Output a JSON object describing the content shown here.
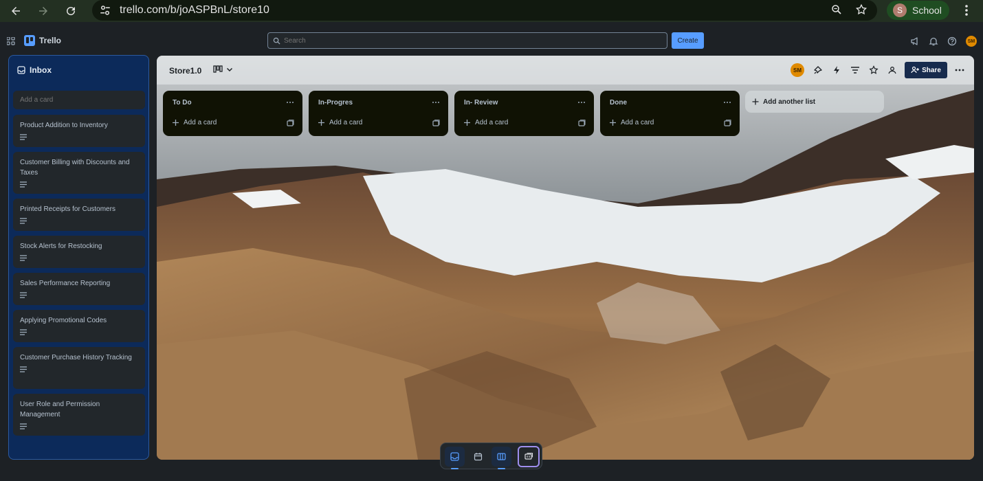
{
  "browser": {
    "url": "trello.com/b/joASPBnL/store10",
    "profile_initial": "S",
    "profile_name": "School"
  },
  "header": {
    "app_name": "Trello",
    "search_placeholder": "Search",
    "create_label": "Create",
    "avatar_initials": "SM"
  },
  "inbox": {
    "title": "Inbox",
    "add_card_placeholder": "Add a card",
    "cards": [
      {
        "title": "Product Addition to Inventory"
      },
      {
        "title": "Customer Billing with Discounts and Taxes"
      },
      {
        "title": "Printed Receipts for Customers"
      },
      {
        "title": "Stock Alerts for Restocking"
      },
      {
        "title": "Sales Performance Reporting"
      },
      {
        "title": "Applying Promotional Codes"
      },
      {
        "title": "Customer Purchase History Tracking"
      },
      {
        "title": "User Role and Permission Management"
      }
    ]
  },
  "board": {
    "title": "Store1.0",
    "member_initials": "SM",
    "share_label": "Share",
    "lists": [
      {
        "title": "To Do",
        "add_label": "Add a card"
      },
      {
        "title": "In-Progres",
        "add_label": "Add a card"
      },
      {
        "title": "In- Review",
        "add_label": "Add a card"
      },
      {
        "title": "Done",
        "add_label": "Add a card"
      }
    ],
    "add_list_label": "Add another list"
  },
  "colors": {
    "accent": "#579dff",
    "inbox_bg": "#0c2a5a",
    "list_bg": "#101204",
    "share_bg": "#172b4d"
  }
}
